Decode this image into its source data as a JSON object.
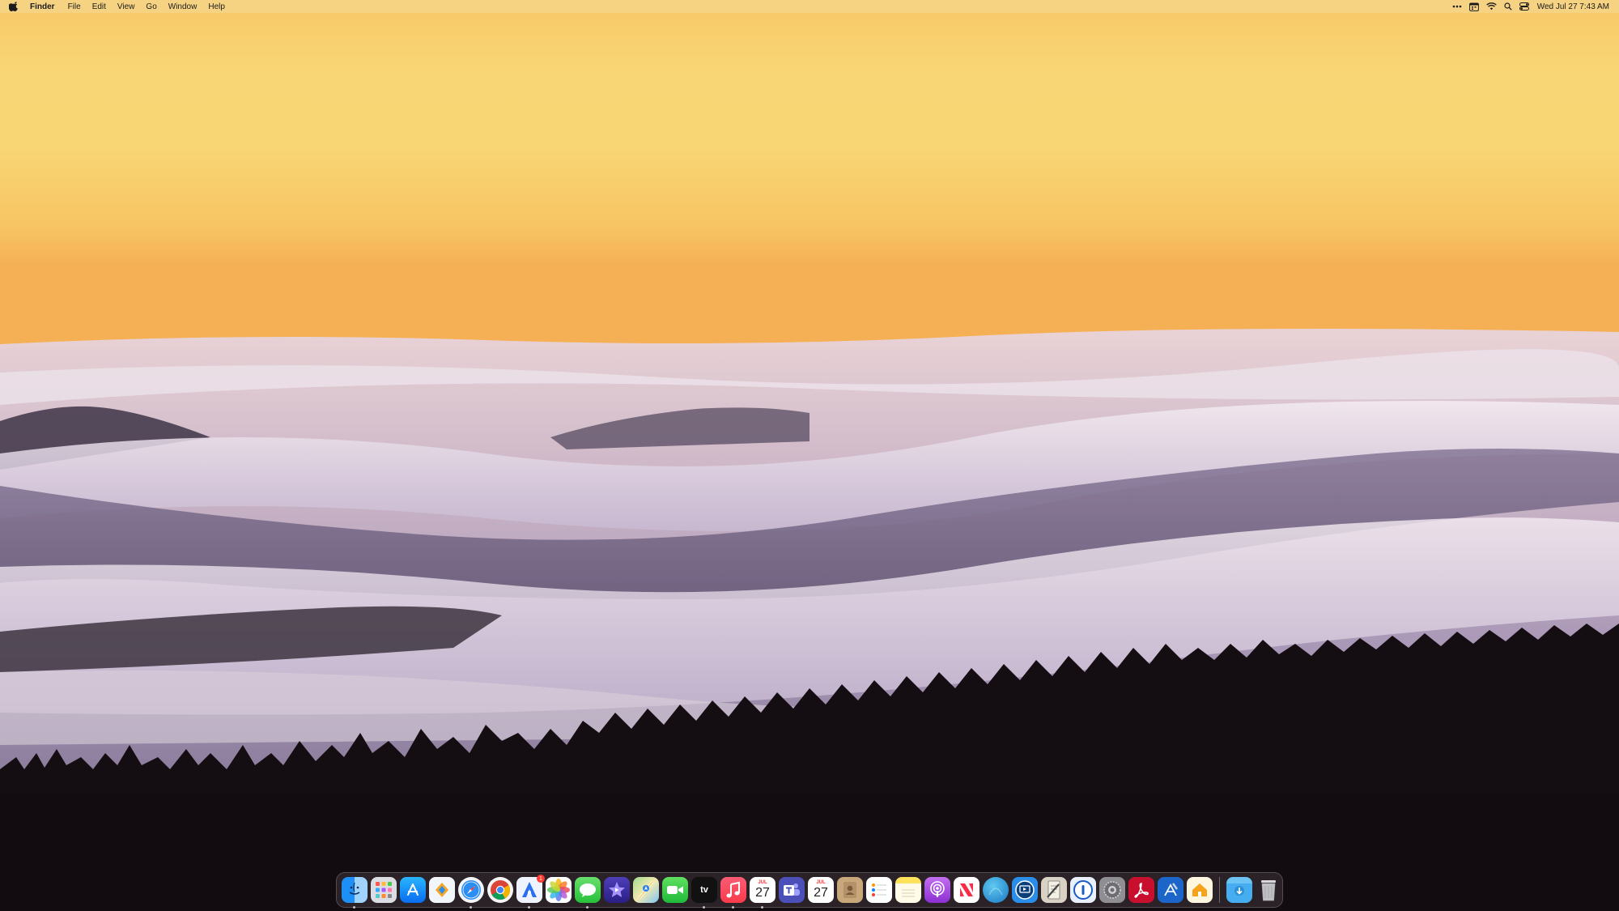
{
  "menubar": {
    "app_name": "Finder",
    "menus": [
      "File",
      "Edit",
      "View",
      "Go",
      "Window",
      "Help"
    ],
    "clock": "Wed Jul 27  7:43 AM",
    "status_icons": [
      "more-icon",
      "calendar-icon",
      "wifi-icon",
      "spotlight-icon",
      "control-center-icon"
    ]
  },
  "dock": {
    "items": [
      {
        "name": "finder",
        "running": true
      },
      {
        "name": "launchpad"
      },
      {
        "name": "app-store"
      },
      {
        "name": "copilot"
      },
      {
        "name": "safari",
        "running": true
      },
      {
        "name": "chrome"
      },
      {
        "name": "instruments",
        "running": true,
        "badge": "1"
      },
      {
        "name": "photos"
      },
      {
        "name": "messages",
        "running": true
      },
      {
        "name": "imovie"
      },
      {
        "name": "maps"
      },
      {
        "name": "facetime"
      },
      {
        "name": "apple-tv",
        "label": "tv",
        "running": true
      },
      {
        "name": "music",
        "running": true
      },
      {
        "name": "calendar",
        "month": "JUL",
        "day": "27",
        "running": true
      },
      {
        "name": "teams"
      },
      {
        "name": "fantastical",
        "month": "JUL",
        "day": "27"
      },
      {
        "name": "contacts"
      },
      {
        "name": "reminders"
      },
      {
        "name": "notes"
      },
      {
        "name": "podcasts"
      },
      {
        "name": "news"
      },
      {
        "name": "network-radar"
      },
      {
        "name": "screens"
      },
      {
        "name": "script-editor"
      },
      {
        "name": "1password"
      },
      {
        "name": "system-settings"
      },
      {
        "name": "acrobat"
      },
      {
        "name": "xcode"
      },
      {
        "name": "home"
      },
      {
        "name": "downloads-folder"
      },
      {
        "name": "trash"
      }
    ]
  },
  "colors": {
    "sky_top": "#f7c766",
    "sky_mid": "#f9d675",
    "horizon": "#f5b055",
    "cloud_light": "#f0e8ee",
    "cloud_shadow": "#8e7ea0",
    "forest": "#120c10"
  }
}
